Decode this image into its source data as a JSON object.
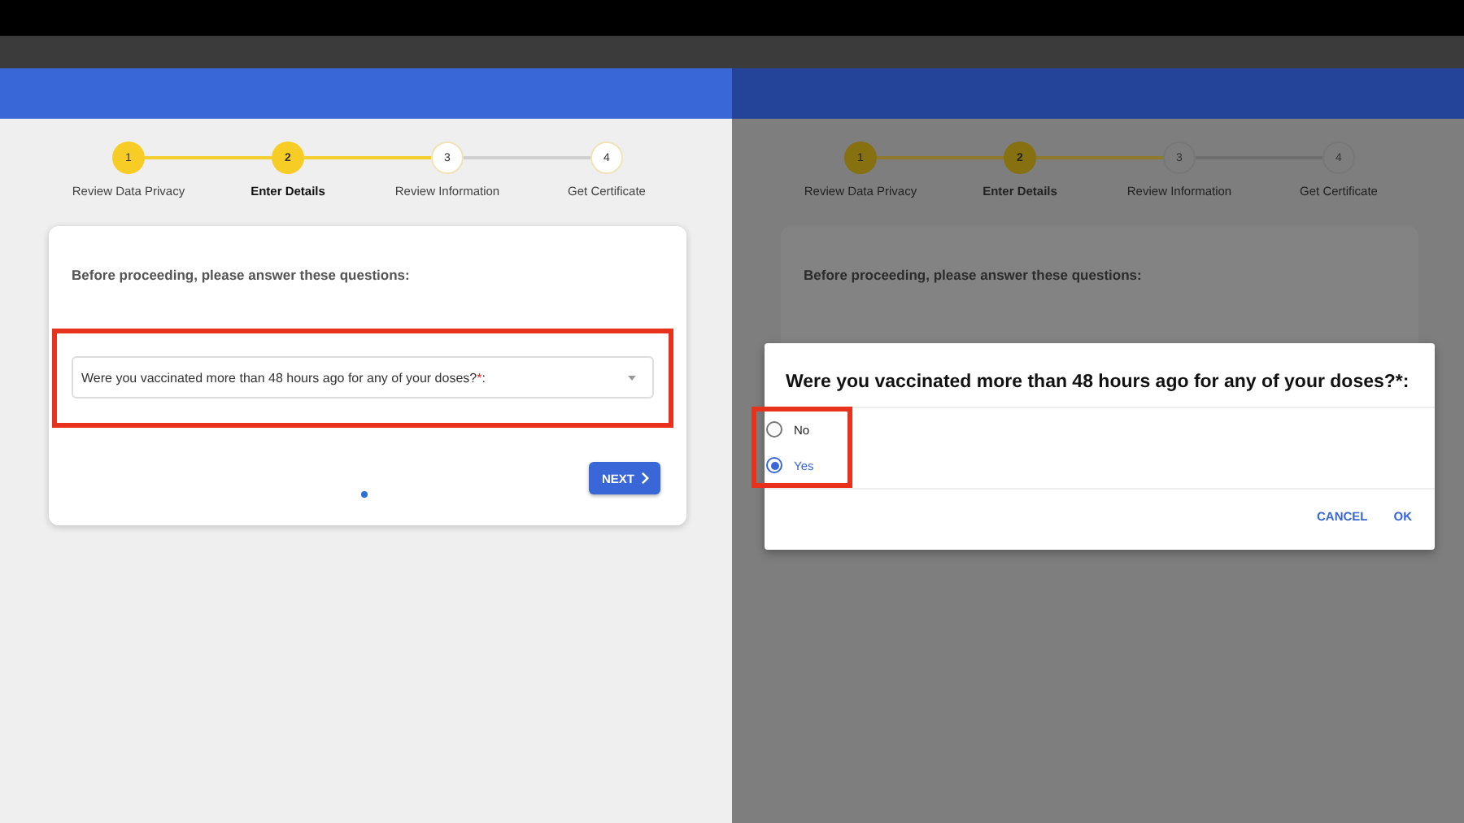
{
  "left_screen": {
    "stepper": [
      {
        "number": "1",
        "label": "Review Data Privacy",
        "completed": true,
        "active": false
      },
      {
        "number": "2",
        "label": "Enter Details",
        "completed": false,
        "active": true
      },
      {
        "number": "3",
        "label": "Review Information",
        "completed": false,
        "active": false
      },
      {
        "number": "4",
        "label": "Get Certificate",
        "completed": false,
        "active": false
      }
    ],
    "card": {
      "heading": "Before proceeding, please answer these questions:",
      "question": {
        "label": "Were you vaccinated more than 48 hours ago for any of your doses?",
        "required_mark": "*",
        "label_end": ":",
        "highlighted": true
      },
      "next_button": "NEXT",
      "page_dots": [
        {
          "selected": true
        }
      ]
    }
  },
  "right_screen": {
    "stepper": [
      {
        "number": "1",
        "label": "Review Data Privacy",
        "completed": true,
        "active": false
      },
      {
        "number": "2",
        "label": "Enter Details",
        "completed": false,
        "active": true
      },
      {
        "number": "3",
        "label": "Review Information",
        "completed": false,
        "active": false
      },
      {
        "number": "4",
        "label": "Get Certificate",
        "completed": false,
        "active": false
      }
    ],
    "card": {
      "heading": "Before proceeding, please answer these questions:"
    },
    "dialog": {
      "title": "Were you vaccinated more than 48 hours ago for any of your doses?*:",
      "options_highlighted": true,
      "options": [
        {
          "label": "No",
          "selected": false
        },
        {
          "label": "Yes",
          "selected": true
        }
      ],
      "buttons": [
        "CANCEL",
        "OK"
      ]
    }
  }
}
